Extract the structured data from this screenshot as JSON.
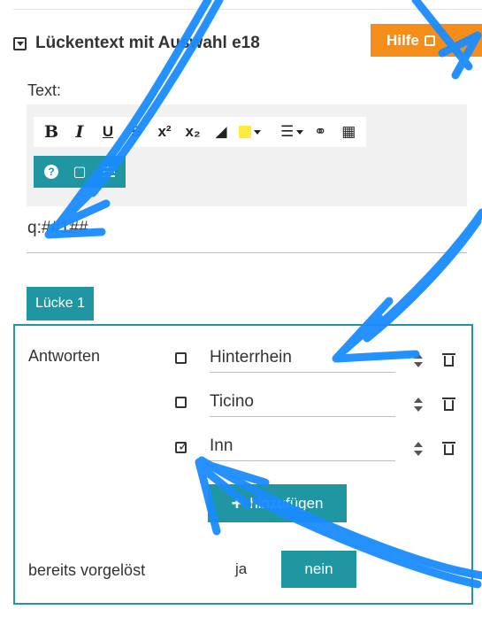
{
  "header": {
    "title": "Lückentext mit Auswahl e18",
    "help_label": "Hilfe"
  },
  "editor": {
    "label": "Text:",
    "toolbar": {
      "bold": "B",
      "italic": "I",
      "underline": "U",
      "strike": "S",
      "superscript": "x²",
      "subscript": "x₂",
      "list": "☰",
      "link": "🔗",
      "calculator": "▦"
    },
    "content": "q:##1##"
  },
  "gap": {
    "tab_label": "Lücke 1",
    "answers_label": "Antworten",
    "answers": [
      {
        "value": "Hinterrhein",
        "checked": false
      },
      {
        "value": "Ticino",
        "checked": false
      },
      {
        "value": "Inn",
        "checked": true
      }
    ],
    "add_label": "hinzufügen",
    "presolved_label": "bereits vorgelöst",
    "yes_label": "ja",
    "no_label": "nein"
  },
  "colors": {
    "accent": "#2196a3",
    "help": "#f58e19",
    "scribble": "#1a8cff"
  }
}
